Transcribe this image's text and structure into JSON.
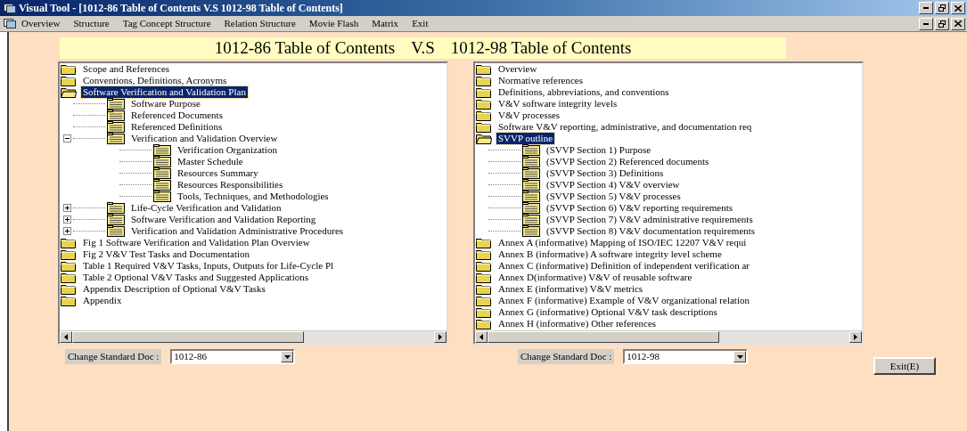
{
  "window": {
    "title": "Visual Tool - [1012-86 Table of Contents   V.S   1012-98 Table of Contents]"
  },
  "menu": [
    "Overview",
    "Structure",
    "Tag Concept Structure",
    "Relation Structure",
    "Movie Flash",
    "Matrix",
    "Exit"
  ],
  "header": {
    "left": "1012-86 Table of Contents",
    "vs": "V.S",
    "right": "1012-98 Table of Contents"
  },
  "panels": [
    {
      "tree": [
        {
          "label": "Scope and References",
          "kind": "folder",
          "selected": false
        },
        {
          "label": "Conventions, Definitions, Acronyms",
          "kind": "folder",
          "selected": false
        },
        {
          "label": "Software Verification and Validation Plan",
          "kind": "folder",
          "selected": true,
          "expanded": true,
          "children": [
            {
              "label": "Software Purpose",
              "kind": "page",
              "selected": false
            },
            {
              "label": "Referenced Documents",
              "kind": "page",
              "selected": false
            },
            {
              "label": "Referenced Definitions",
              "kind": "page",
              "selected": false
            },
            {
              "label": "Verification and Validation Overview",
              "kind": "page",
              "selected": false,
              "expanded": true,
              "children": [
                {
                  "label": "Verification Organization",
                  "kind": "page",
                  "selected": false
                },
                {
                  "label": "Master Schedule",
                  "kind": "page",
                  "selected": false
                },
                {
                  "label": "Resources Summary",
                  "kind": "page",
                  "selected": false
                },
                {
                  "label": "Resources Responsibilities",
                  "kind": "page",
                  "selected": false
                },
                {
                  "label": "Tools, Techniques, and Methodologies",
                  "kind": "page",
                  "selected": false
                }
              ]
            },
            {
              "label": "Life-Cycle Verification and Validation",
              "kind": "page",
              "selected": false,
              "expanded": false
            },
            {
              "label": "Software Verification and Validation Reporting",
              "kind": "page",
              "selected": false,
              "expanded": false
            },
            {
              "label": "Verification and Validation Administrative Procedures",
              "kind": "page",
              "selected": false,
              "expanded": false
            }
          ]
        },
        {
          "label": "Fig 1 Software Verification and Validation Plan Overview",
          "kind": "folder",
          "selected": false
        },
        {
          "label": "Fig 2 V&V Test Tasks and Documentation",
          "kind": "folder",
          "selected": false
        },
        {
          "label": "Table 1 Required V&V Tasks, Inputs, Outputs for Life-Cycle Pl",
          "kind": "folder",
          "selected": false
        },
        {
          "label": "Table 2 Optional V&V Tasks and Suggested Applications",
          "kind": "folder",
          "selected": false
        },
        {
          "label": "Appendix Description of Optional V&V Tasks",
          "kind": "folder",
          "selected": false
        },
        {
          "label": "Appendix",
          "kind": "folder",
          "selected": false
        }
      ],
      "doc_label": "Change Standard Doc :",
      "doc_value": "1012-86"
    },
    {
      "tree": [
        {
          "label": "Overview",
          "kind": "folder",
          "selected": false
        },
        {
          "label": "Normative references",
          "kind": "folder",
          "selected": false
        },
        {
          "label": "Definitions, abbreviations, and conventions",
          "kind": "folder",
          "selected": false
        },
        {
          "label": "V&V software integrity levels",
          "kind": "folder",
          "selected": false
        },
        {
          "label": "V&V processes",
          "kind": "folder",
          "selected": false
        },
        {
          "label": "Software V&V reporting, administrative, and documentation req",
          "kind": "folder",
          "selected": false
        },
        {
          "label": "SVVP outline",
          "kind": "folder",
          "selected": true,
          "expanded": true,
          "children": [
            {
              "label": "(SVVP Section 1) Purpose",
              "kind": "page",
              "selected": false
            },
            {
              "label": "(SVVP Section 2) Referenced documents",
              "kind": "page",
              "selected": false
            },
            {
              "label": "(SVVP Section 3) Definitions",
              "kind": "page",
              "selected": false
            },
            {
              "label": "(SVVP Section 4) V&V overview",
              "kind": "page",
              "selected": false
            },
            {
              "label": "(SVVP Section 5) V&V processes",
              "kind": "page",
              "selected": false
            },
            {
              "label": "(SVVP Section 6) V&V reporting requirements",
              "kind": "page",
              "selected": false
            },
            {
              "label": "(SVVP Section 7) V&V administrative requirements",
              "kind": "page",
              "selected": false
            },
            {
              "label": "(SVVP Section 8) V&V documentation requirements",
              "kind": "page",
              "selected": false
            }
          ]
        },
        {
          "label": "Annex A (informative) Mapping of ISO/IEC 12207 V&V requi",
          "kind": "folder",
          "selected": false
        },
        {
          "label": "Annex B (informative) A software integrity level scheme",
          "kind": "folder",
          "selected": false
        },
        {
          "label": "Annex C (informative) Definition of independent verification ar",
          "kind": "folder",
          "selected": false
        },
        {
          "label": "Annex D(informative) V&V of reusable software",
          "kind": "folder",
          "selected": false
        },
        {
          "label": "Annex E (informative) V&V metrics",
          "kind": "folder",
          "selected": false
        },
        {
          "label": "Annex F (informative) Example of V&V organizational relation",
          "kind": "folder",
          "selected": false
        },
        {
          "label": "Annex G (informative) Optional V&V task descriptions",
          "kind": "folder",
          "selected": false
        },
        {
          "label": "Annex H (informative) Other references",
          "kind": "folder",
          "selected": false
        }
      ],
      "doc_label": "Change Standard Doc :",
      "doc_value": "1012-98"
    }
  ],
  "exit_button": "Exit(E)"
}
